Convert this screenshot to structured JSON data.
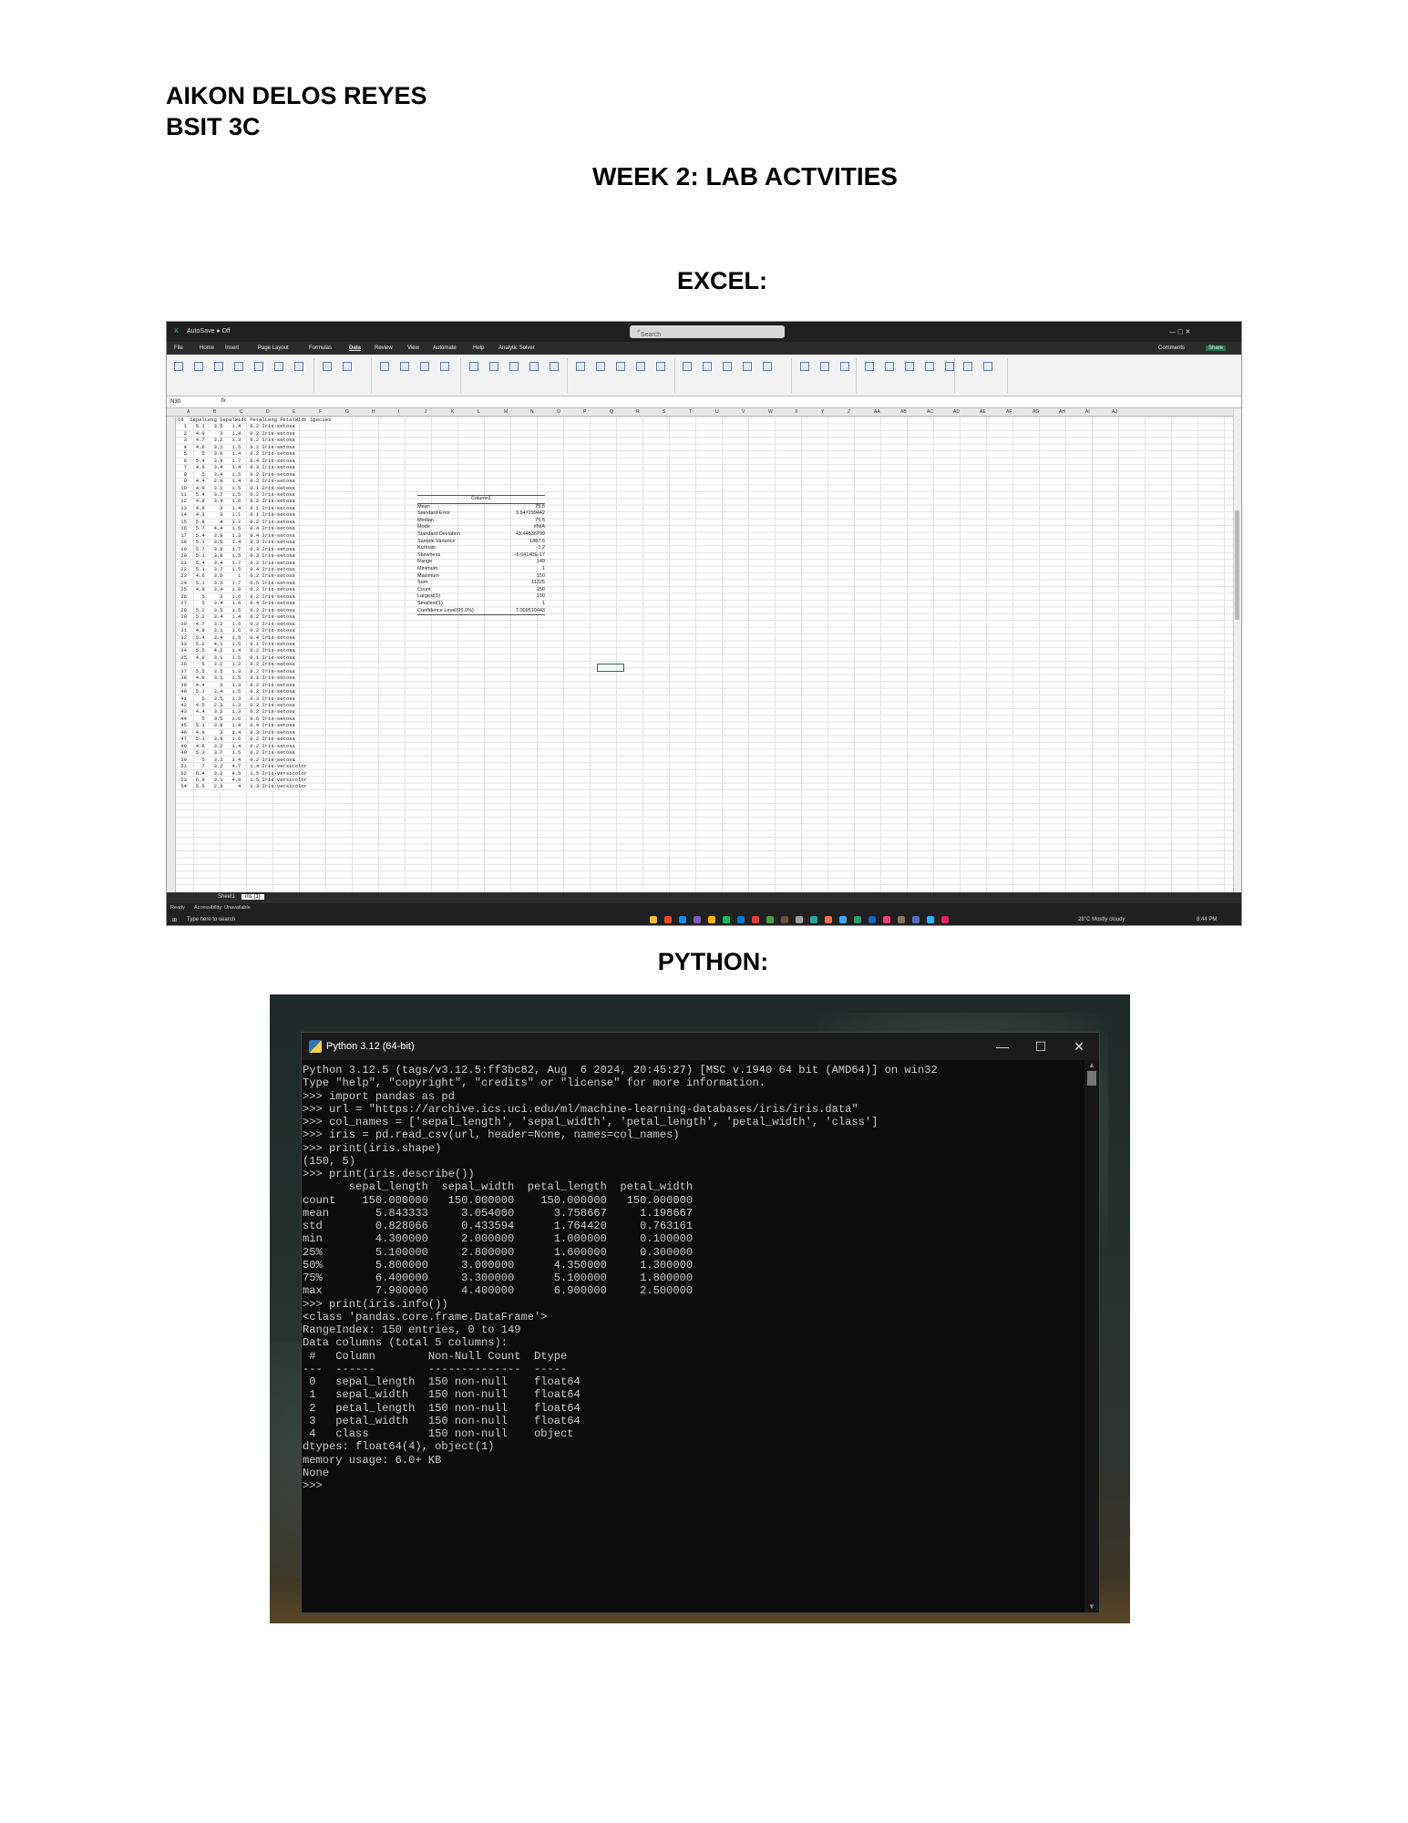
{
  "header": {
    "name": "AIKON DELOS REYES",
    "section": "BSIT 3C",
    "title": "WEEK 2: LAB ACTVITIES"
  },
  "sections": {
    "excel_title": "EXCEL:",
    "python_title": "PYTHON:"
  },
  "excel": {
    "search": "Search",
    "menu": [
      "File",
      "Home",
      "Insert",
      "Page Layout",
      "Formulas",
      "Data",
      "Review",
      "View",
      "Automate",
      "Help",
      "Analytic Solver"
    ],
    "active_menu": "Data",
    "comments": "Comments",
    "share": "Share",
    "name_box": "N30",
    "columns": [
      "A",
      "B",
      "C",
      "D",
      "E",
      "F",
      "G",
      "H",
      "I",
      "J",
      "K",
      "L",
      "M",
      "N",
      "O",
      "P",
      "Q",
      "R",
      "S",
      "T",
      "U",
      "V",
      "W",
      "X",
      "Y",
      "Z",
      "AA",
      "AB",
      "AC",
      "AD",
      "AE",
      "AF",
      "AG",
      "AH",
      "AI",
      "AJ"
    ],
    "data_header": "Id  SepalLeng SepalWidt PetalLeng PetalWidt Species",
    "rows": [
      "  1   5.1   3.5   1.4   0.2 Iris-setosa",
      "  2   4.9     3   1.4   0.2 Iris-setosa",
      "  3   4.7   3.2   1.3   0.2 Iris-setosa",
      "  4   4.6   3.1   1.5   0.2 Iris-setosa",
      "  5     5   3.6   1.4   0.2 Iris-setosa",
      "  6   5.4   3.9   1.7   0.4 Iris-setosa",
      "  7   4.6   3.4   1.4   0.3 Iris-setosa",
      "  8     5   3.4   1.5   0.2 Iris-setosa",
      "  9   4.4   2.9   1.4   0.2 Iris-setosa",
      " 10   4.9   3.1   1.5   0.1 Iris-setosa",
      " 11   5.4   3.7   1.5   0.2 Iris-setosa",
      " 12   4.8   3.4   1.6   0.2 Iris-setosa",
      " 13   4.8     3   1.4   0.1 Iris-setosa",
      " 14   4.3     3   1.1   0.1 Iris-setosa",
      " 15   5.8     4   1.2   0.2 Iris-setosa",
      " 16   5.7   4.4   1.5   0.4 Iris-setosa",
      " 17   5.4   3.9   1.3   0.4 Iris-setosa",
      " 18   5.1   3.5   1.4   0.3 Iris-setosa",
      " 19   5.7   3.8   1.7   0.3 Iris-setosa",
      " 20   5.1   3.8   1.5   0.3 Iris-setosa",
      " 21   5.4   3.4   1.7   0.2 Iris-setosa",
      " 22   5.1   3.7   1.5   0.4 Iris-setosa",
      " 23   4.6   3.6     1   0.2 Iris-setosa",
      " 24   5.1   3.3   1.7   0.5 Iris-setosa",
      " 25   4.8   3.4   1.9   0.2 Iris-setosa",
      " 26     5     3   1.6   0.2 Iris-setosa",
      " 27     5   3.4   1.6   0.4 Iris-setosa",
      " 28   5.2   3.5   1.5   0.2 Iris-setosa",
      " 29   5.2   3.4   1.4   0.2 Iris-setosa",
      " 30   4.7   3.2   1.6   0.2 Iris-setosa",
      " 31   4.8   3.1   1.6   0.2 Iris-setosa",
      " 32   5.4   3.4   1.5   0.4 Iris-setosa",
      " 33   5.2   4.1   1.5   0.1 Iris-setosa",
      " 34   5.5   4.2   1.4   0.2 Iris-setosa",
      " 35   4.9   3.1   1.5   0.1 Iris-setosa",
      " 36     5   3.2   1.2   0.2 Iris-setosa",
      " 37   5.5   3.5   1.3   0.2 Iris-setosa",
      " 38   4.9   3.1   1.5   0.1 Iris-setosa",
      " 39   4.4     3   1.3   0.2 Iris-setosa",
      " 40   5.1   3.4   1.5   0.2 Iris-setosa",
      " 41     5   3.5   1.3   0.3 Iris-setosa",
      " 42   4.5   2.3   1.3   0.3 Iris-setosa",
      " 43   4.4   3.2   1.3   0.2 Iris-setosa",
      " 44     5   3.5   1.6   0.6 Iris-setosa",
      " 45   5.1   3.8   1.9   0.4 Iris-setosa",
      " 46   4.8     3   1.4   0.3 Iris-setosa",
      " 47   5.1   3.8   1.6   0.2 Iris-setosa",
      " 48   4.6   3.2   1.4   0.2 Iris-setosa",
      " 49   5.3   3.7   1.5   0.2 Iris-setosa",
      " 50     5   3.3   1.4   0.2 Iris-setosa",
      " 51     7   3.2   4.7   1.4 Iris-versicolor",
      " 52   6.4   3.2   4.5   1.5 Iris-versicolor",
      " 53   6.9   3.1   4.9   1.5 Iris-versicolor",
      " 54   5.5   2.3     4   1.3 Iris-versicolor"
    ],
    "stats_header": "Column1",
    "stats": [
      {
        "label": "Mean",
        "value": "75.5"
      },
      {
        "label": "Standard Error",
        "value": "3.547299442"
      },
      {
        "label": "Median",
        "value": "75.5"
      },
      {
        "label": "Mode",
        "value": "#N/A"
      },
      {
        "label": "Standard Deviation",
        "value": "43.44536799"
      },
      {
        "label": "Sample Variance",
        "value": "1887.5"
      },
      {
        "label": "Kurtosis",
        "value": "-1.2"
      },
      {
        "label": "Skewness",
        "value": "-6.04140E-17"
      },
      {
        "label": "Range",
        "value": "149"
      },
      {
        "label": "Minimum",
        "value": "1"
      },
      {
        "label": "Maximum",
        "value": "150"
      },
      {
        "label": "Sum",
        "value": "11325"
      },
      {
        "label": "Count",
        "value": "150"
      },
      {
        "label": "Largest(1)",
        "value": "150"
      },
      {
        "label": "Smallest(1)",
        "value": "1"
      },
      {
        "label": "Confidence Level(95.0%)",
        "value": "7.009510443"
      }
    ],
    "sheet_tabs": [
      "Sheet1",
      "iris (1)"
    ],
    "active_sheet": "iris (1)",
    "status_ready": "Ready",
    "status_accessibility": "Accessibility: Unavailable",
    "taskbar_search": "Type here to search",
    "weather": "28°C  Mostly cloudy",
    "clock": "8:44 PM"
  },
  "python": {
    "window_title": "Python 3.12 (64-bit)",
    "console_lines": [
      "Python 3.12.5 (tags/v3.12.5:ff3bc82, Aug  6 2024, 20:45:27) [MSC v.1940 64 bit (AMD64)] on win32",
      "Type \"help\", \"copyright\", \"credits\" or \"license\" for more information.",
      ">>> import pandas as pd",
      ">>> url = \"https://archive.ics.uci.edu/ml/machine-learning-databases/iris/iris.data\"",
      ">>> col_names = ['sepal_length', 'sepal_width', 'petal_length', 'petal_width', 'class']",
      ">>> iris = pd.read_csv(url, header=None, names=col_names)",
      ">>> print(iris.shape)",
      "(150, 5)",
      ">>> print(iris.describe())",
      "       sepal_length  sepal_width  petal_length  petal_width",
      "count    150.000000   150.000000    150.000000   150.000000",
      "mean       5.843333     3.054000      3.758667     1.198667",
      "std        0.828066     0.433594      1.764420     0.763161",
      "min        4.300000     2.000000      1.000000     0.100000",
      "25%        5.100000     2.800000      1.600000     0.300000",
      "50%        5.800000     3.000000      4.350000     1.300000",
      "75%        6.400000     3.300000      5.100000     1.800000",
      "max        7.900000     4.400000      6.900000     2.500000",
      ">>> print(iris.info())",
      "<class 'pandas.core.frame.DataFrame'>",
      "RangeIndex: 150 entries, 0 to 149",
      "Data columns (total 5 columns):",
      " #   Column        Non-Null Count  Dtype",
      "---  ------        --------------  -----",
      " 0   sepal_length  150 non-null    float64",
      " 1   sepal_width   150 non-null    float64",
      " 2   petal_length  150 non-null    float64",
      " 3   petal_width   150 non-null    float64",
      " 4   class         150 non-null    object",
      "dtypes: float64(4), object(1)",
      "memory usage: 6.0+ KB",
      "None",
      ">>>"
    ]
  }
}
